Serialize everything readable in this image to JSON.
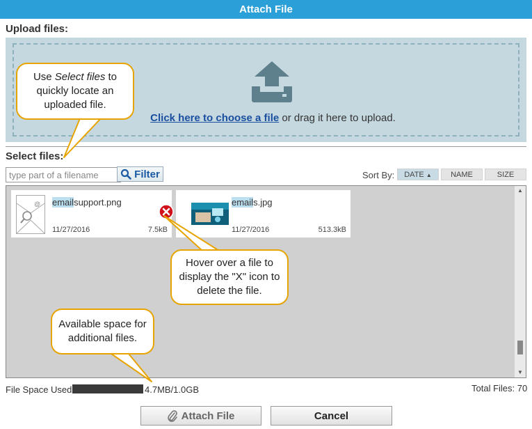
{
  "window": {
    "title": "Attach File"
  },
  "upload": {
    "heading": "Upload files:",
    "link_text": "Click here to choose a file",
    "suffix_text": " or drag it here to upload.",
    "icon": "upload-icon"
  },
  "select": {
    "heading": "Select files:",
    "filter_placeholder": "type part of a filename",
    "filter_label": "Filter",
    "sort_label": "Sort By:",
    "sort_buttons": [
      {
        "label": "DATE",
        "active": true,
        "indicator": "▲"
      },
      {
        "label": "NAME",
        "active": false
      },
      {
        "label": "SIZE",
        "active": false
      }
    ]
  },
  "files": [
    {
      "name_match": "email",
      "name_rest": "support.png",
      "date": "11/27/2016",
      "size": "7.5kB",
      "thumbnail": "envelope-icon",
      "delete_visible": true
    },
    {
      "name_match": "email",
      "name_rest": "s.jpg",
      "date": "11/27/2016",
      "size": "513.3kB",
      "thumbnail": "photo-thumbnail"
    }
  ],
  "footer": {
    "space_label": "File Space Used:",
    "space_value": "4.7MB/1.0GB",
    "total_label": "Total Files: 70",
    "attach_label": "Attach File",
    "cancel_label": "Cancel"
  },
  "callouts": {
    "select_files_pre": "Use ",
    "select_files_em": "Select files",
    "select_files_post": " to quickly locate an uploaded file.",
    "delete_hint": "Hover over a file to display the \"X\" icon to delete the file.",
    "space_hint": "Available space for additional files."
  },
  "colors": {
    "titlebar": "#2a9fd8",
    "upload_panel": "#c5d8e0",
    "file_area": "#d0d0d0",
    "callout_border": "#e7a400",
    "delete": "#d0101a",
    "link": "#1a4fa0"
  }
}
